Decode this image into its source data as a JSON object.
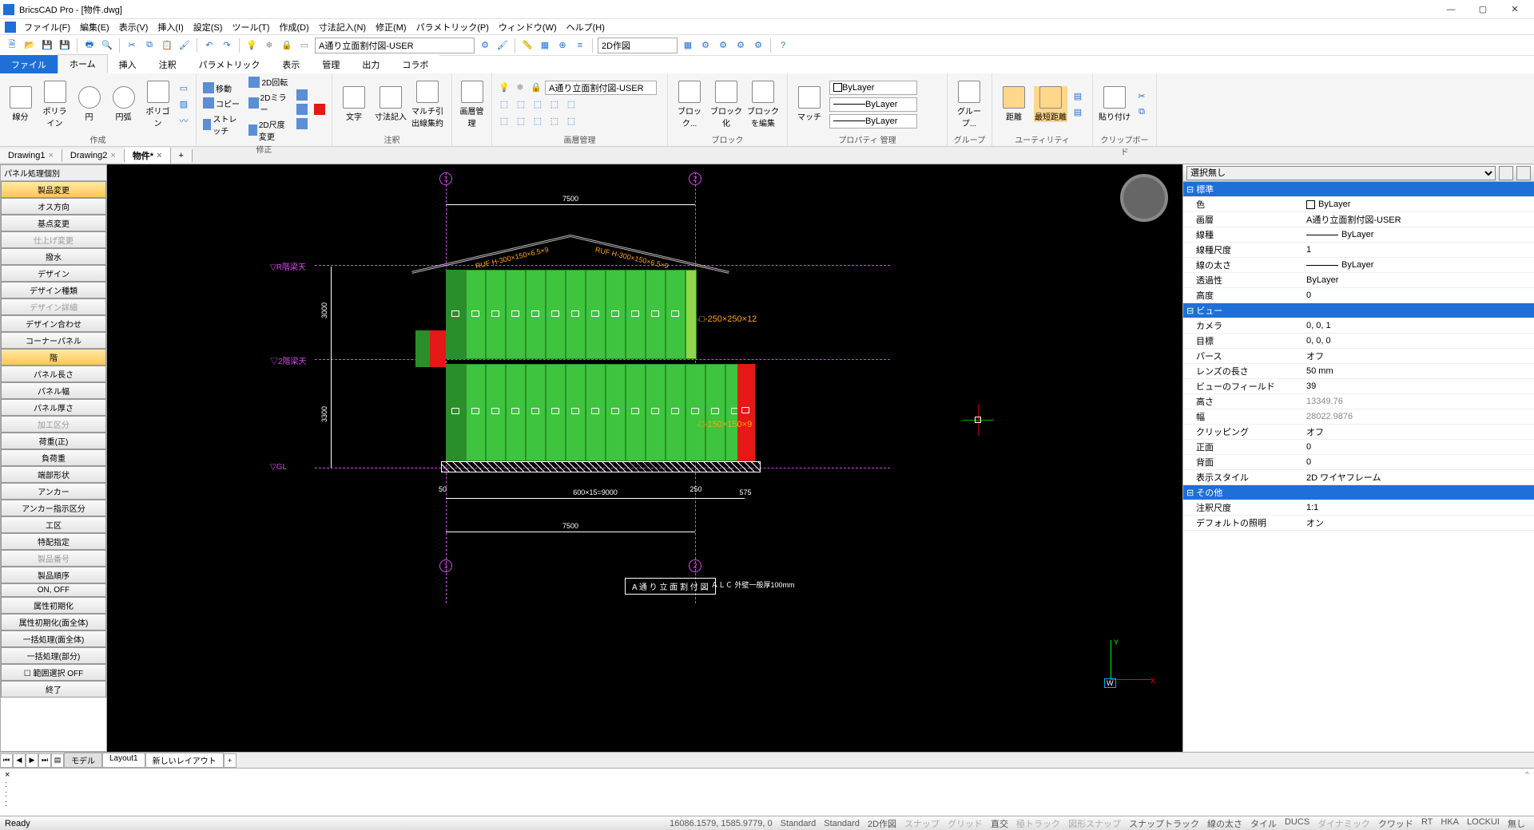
{
  "app": {
    "title": "BricsCAD Pro - [物件.dwg]"
  },
  "menus": [
    "ファイル(F)",
    "編集(E)",
    "表示(V)",
    "挿入(I)",
    "設定(S)",
    "ツール(T)",
    "作成(D)",
    "寸法記入(N)",
    "修正(M)",
    "パラメトリック(P)",
    "ウィンドウ(W)",
    "ヘルプ(H)"
  ],
  "toolbar": {
    "layer_combo": "A通り立面割付図-USER",
    "space_combo": "2D作図"
  },
  "ribbon_tabs": [
    "ファイル",
    "ホーム",
    "挿入",
    "注釈",
    "パラメトリック",
    "表示",
    "管理",
    "出力",
    "コラボ"
  ],
  "ribbon_active": 1,
  "ribbon": {
    "g1": {
      "label": "作成",
      "items": [
        "線分",
        "ポリライン",
        "円",
        "円弧",
        "ポリゴン"
      ]
    },
    "g2": {
      "label": "修正",
      "items": [
        "移動",
        "コピー",
        "ストレッチ",
        "2D回転",
        "2Dミラー",
        "2D尺度変更"
      ]
    },
    "g3": {
      "label": "注釈",
      "items": [
        "文字",
        "寸法記入",
        "マルチ引出線集約"
      ]
    },
    "g4": {
      "label": "画層管理",
      "btn": "画層管理",
      "combo": "A通り立面割付図-USER"
    },
    "g5": {
      "label": "ブロック",
      "items": [
        "ブロック...",
        "ブロック化",
        "ブロックを編集"
      ]
    },
    "g6": {
      "label": "プロパティ 管理",
      "btn": "マッチ",
      "combos": [
        "ByLayer",
        "ByLayer",
        "ByLayer"
      ]
    },
    "g7": {
      "label": "グループ",
      "btn": "グループ..."
    },
    "g8": {
      "label": "ユーティリティ",
      "items": [
        "距離",
        "最短距離"
      ]
    },
    "g9": {
      "label": "クリップボード",
      "btn": "貼り付け"
    }
  },
  "doc_tabs": [
    {
      "name": "Drawing1",
      "active": false
    },
    {
      "name": "Drawing2",
      "active": false
    },
    {
      "name": "物件*",
      "active": true
    }
  ],
  "sidepanel": {
    "title": "パネル処理個別",
    "buttons": [
      {
        "t": "製品変更",
        "hl": true
      },
      {
        "t": "オス方向"
      },
      {
        "t": "基点変更"
      },
      {
        "t": "仕上げ変更",
        "dis": true
      },
      {
        "t": "撥水"
      },
      {
        "t": "デザイン"
      },
      {
        "t": "デザイン種類"
      },
      {
        "t": "デザイン詳細",
        "dis": true
      },
      {
        "t": "デザイン合わせ"
      },
      {
        "t": "コーナーパネル"
      },
      {
        "t": "階",
        "hl": true
      },
      {
        "t": "パネル長さ"
      },
      {
        "t": "パネル幅"
      },
      {
        "t": "パネル厚さ"
      },
      {
        "t": "加工区分",
        "dis": true
      },
      {
        "t": "荷重(正)"
      },
      {
        "t": "負荷重"
      },
      {
        "t": "端部形状"
      },
      {
        "t": "アンカー"
      },
      {
        "t": "アンカー指示区分"
      },
      {
        "t": "工区"
      },
      {
        "t": "特配指定"
      },
      {
        "t": "製品番号",
        "dis": true
      },
      {
        "t": "製品順序"
      },
      {
        "t": "ON, OFF"
      },
      {
        "t": "属性初期化"
      },
      {
        "t": "属性初期化(面全体)"
      },
      {
        "t": "一括処理(面全体)"
      },
      {
        "t": "一括処理(部分)"
      },
      {
        "t": "範囲選択 OFF",
        "chk": true
      },
      {
        "t": "終了"
      }
    ]
  },
  "drawing": {
    "title": "A 通 り 立 面 割 付 図",
    "subtitle": "ＡＬＣ 外壁一般厚100mm",
    "dims": {
      "top": "7500",
      "bottom": "7500",
      "bottom_run": "600×15=9000",
      "left_u": "3000",
      "left_l": "3300",
      "fifty": "50",
      "r250": "250",
      "r575": "575"
    },
    "labels": {
      "rf": "▽R階梁天",
      "f2": "▽2階梁天",
      "gl": "▽GL"
    },
    "callouts": {
      "c1": "□-250×250×12",
      "c2": "□-150×150×9"
    },
    "roof": {
      "left": "RUF H-300×150×6.5×9",
      "right": "RUF H-300×150×6.5×9"
    },
    "grids": [
      "1",
      "2"
    ]
  },
  "props": {
    "header": "選択無し",
    "rows": [
      {
        "cat": true,
        "k": "標準"
      },
      {
        "k": "色",
        "v": "ByLayer",
        "sw": true
      },
      {
        "k": "画層",
        "v": "A通り立面割付図-USER"
      },
      {
        "k": "線種",
        "v": "ByLayer",
        "ln": true
      },
      {
        "k": "線種尺度",
        "v": "1"
      },
      {
        "k": "線の太さ",
        "v": "ByLayer",
        "ln": true
      },
      {
        "k": "透過性",
        "v": "ByLayer"
      },
      {
        "k": "高度",
        "v": "0"
      },
      {
        "cat": true,
        "k": "ビュー"
      },
      {
        "k": "カメラ",
        "v": "0, 0, 1"
      },
      {
        "k": "目標",
        "v": "0, 0, 0"
      },
      {
        "k": "パース",
        "v": "オフ"
      },
      {
        "k": "レンズの長さ",
        "v": "50 mm"
      },
      {
        "k": "ビューのフィールド",
        "v": "39"
      },
      {
        "k": "高さ",
        "v": "13349.76",
        "ro": true
      },
      {
        "k": "幅",
        "v": "28022.9876",
        "ro": true
      },
      {
        "k": "クリッピング",
        "v": "オフ"
      },
      {
        "k": "正面",
        "v": "0"
      },
      {
        "k": "背面",
        "v": "0"
      },
      {
        "k": "表示スタイル",
        "v": "2D ワイヤフレーム"
      },
      {
        "cat": true,
        "k": "その他"
      },
      {
        "k": "注釈尺度",
        "v": "1:1"
      },
      {
        "k": "デフォルトの照明",
        "v": "オン"
      }
    ]
  },
  "layout_tabs": [
    "モデル",
    "Layout1",
    "新しいレイアウト"
  ],
  "status": {
    "ready": "Ready",
    "coords": "16086.1579, 1585.9779, 0",
    "std1": "Standard",
    "std2": "Standard",
    "mode": "2D作図",
    "items": [
      "スナップ",
      "グリッド",
      "直交",
      "極トラック",
      "図形スナップ",
      "スナップトラック",
      "線の太さ",
      "タイル",
      "DUCS",
      "ダイナミック",
      "クワッド",
      "RT",
      "HKA",
      "LOCKUI",
      "無し"
    ]
  }
}
